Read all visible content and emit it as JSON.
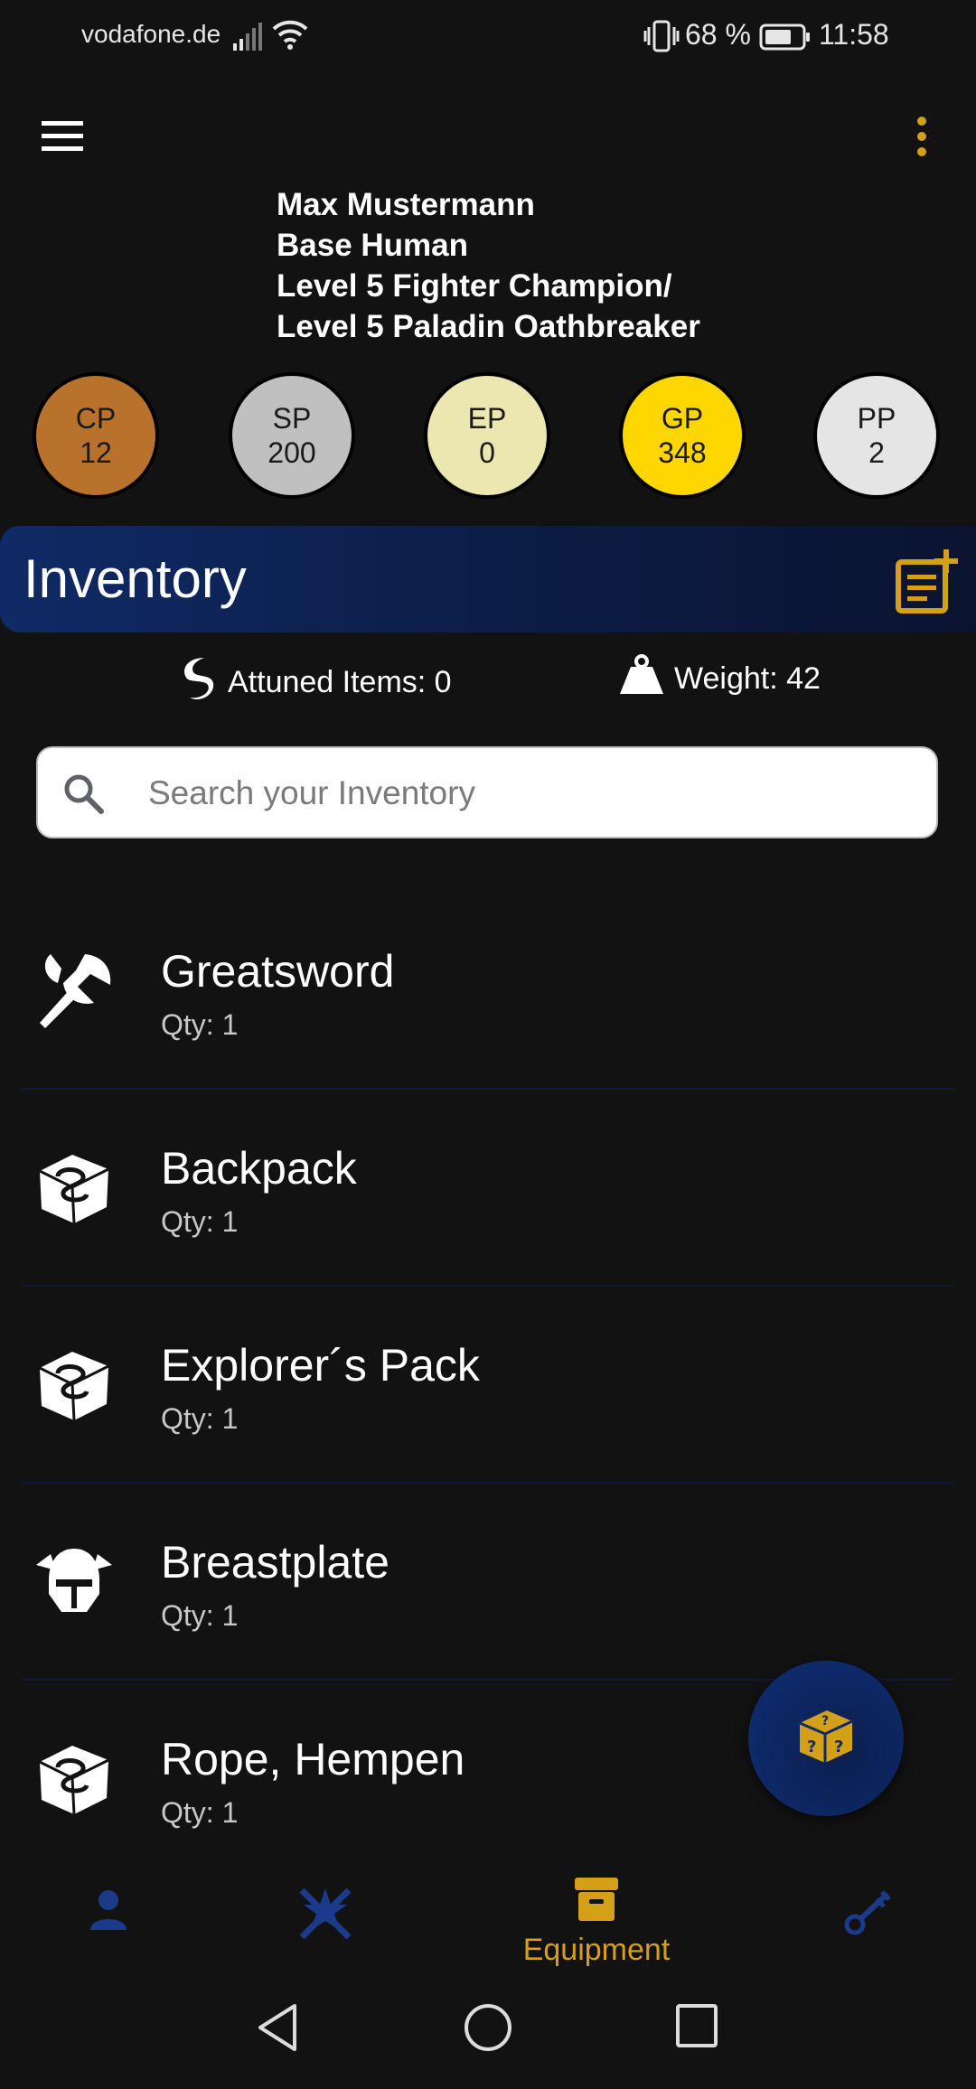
{
  "status_bar": {
    "carrier": "vodafone.de",
    "battery": "68 %",
    "time": "11:58"
  },
  "character": {
    "name": "Max Mustermann",
    "race": "Base Human",
    "class_line_1": "Level 5 Fighter Champion/",
    "class_line_2": "Level 5 Paladin Oathbreaker"
  },
  "coins": [
    {
      "label": "CP",
      "value": "12",
      "color": "#b8722c"
    },
    {
      "label": "SP",
      "value": "200",
      "color": "#c0c0c0"
    },
    {
      "label": "EP",
      "value": "0",
      "color": "#ece6b0"
    },
    {
      "label": "GP",
      "value": "348",
      "color": "#ffd700"
    },
    {
      "label": "PP",
      "value": "2",
      "color": "#e5e5e5"
    }
  ],
  "inventory": {
    "title": "Inventory",
    "attuned_label": "Attuned Items: 0",
    "weight_label": "Weight: 42",
    "search_placeholder": "Search your Inventory",
    "items": [
      {
        "name": "Greatsword",
        "qty": "Qty: 1",
        "icon": "axe-icon"
      },
      {
        "name": "Backpack",
        "qty": "Qty: 1",
        "icon": "gear-die-icon"
      },
      {
        "name": "Explorer´s Pack",
        "qty": "Qty: 1",
        "icon": "gear-die-icon"
      },
      {
        "name": "Breastplate",
        "qty": "Qty: 1",
        "icon": "helmet-icon"
      },
      {
        "name": "Rope, Hempen",
        "qty": "Qty: 1",
        "icon": "gear-die-icon"
      }
    ]
  },
  "bottom_nav": {
    "active_label": "Equipment"
  },
  "colors": {
    "accent": "#d4a017",
    "nav_inactive": "#1c3a8a",
    "header_blue": "#0f2a66",
    "background": "#121212"
  }
}
